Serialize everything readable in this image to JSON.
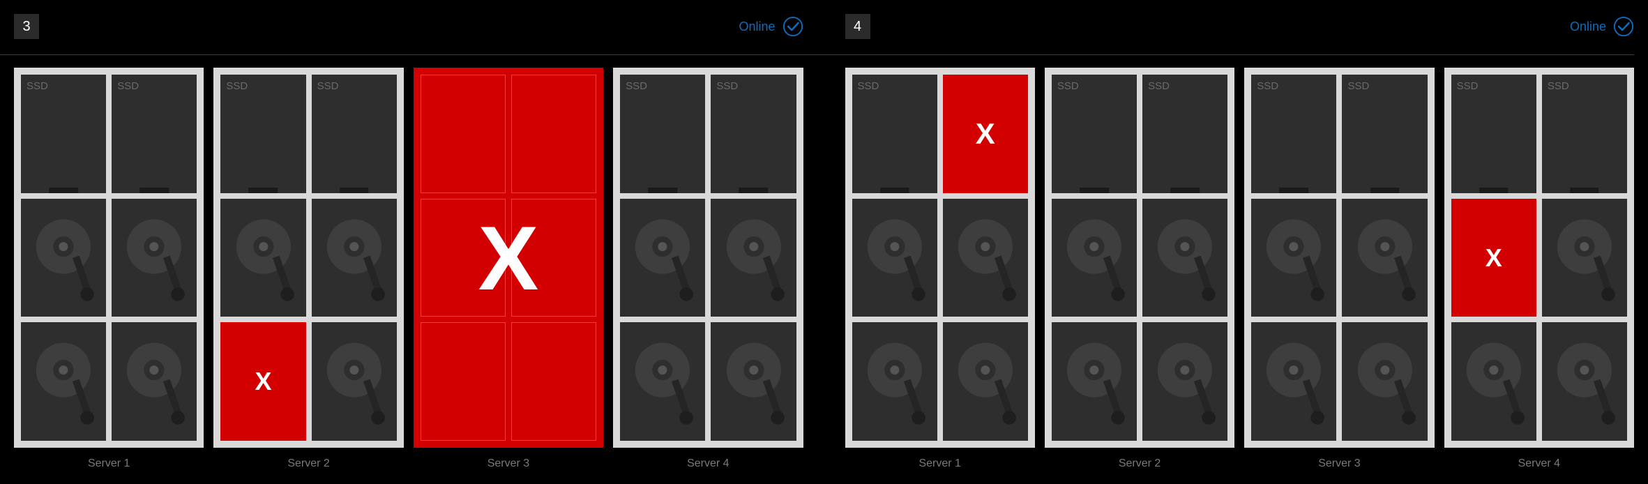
{
  "panels": [
    {
      "id": "3",
      "status": "Online",
      "servers": [
        {
          "name": "Server 1",
          "failed": false,
          "drives": [
            {
              "t": "ssd",
              "f": false
            },
            {
              "t": "ssd",
              "f": false
            },
            {
              "t": "hdd",
              "f": false
            },
            {
              "t": "hdd",
              "f": false
            },
            {
              "t": "hdd",
              "f": false
            },
            {
              "t": "hdd",
              "f": false
            }
          ]
        },
        {
          "name": "Server 2",
          "failed": false,
          "drives": [
            {
              "t": "ssd",
              "f": false
            },
            {
              "t": "ssd",
              "f": false
            },
            {
              "t": "hdd",
              "f": false
            },
            {
              "t": "hdd",
              "f": false
            },
            {
              "t": "hdd",
              "f": true
            },
            {
              "t": "hdd",
              "f": false
            }
          ]
        },
        {
          "name": "Server 3",
          "failed": true,
          "drives": [
            {
              "t": "ssd",
              "f": false
            },
            {
              "t": "ssd",
              "f": false
            },
            {
              "t": "hdd",
              "f": false
            },
            {
              "t": "hdd",
              "f": false
            },
            {
              "t": "hdd",
              "f": false
            },
            {
              "t": "hdd",
              "f": false
            }
          ]
        },
        {
          "name": "Server 4",
          "failed": false,
          "drives": [
            {
              "t": "ssd",
              "f": false
            },
            {
              "t": "ssd",
              "f": false
            },
            {
              "t": "hdd",
              "f": false
            },
            {
              "t": "hdd",
              "f": false
            },
            {
              "t": "hdd",
              "f": false
            },
            {
              "t": "hdd",
              "f": false
            }
          ]
        }
      ]
    },
    {
      "id": "4",
      "status": "Online",
      "servers": [
        {
          "name": "Server 1",
          "failed": false,
          "drives": [
            {
              "t": "ssd",
              "f": false
            },
            {
              "t": "ssd",
              "f": true
            },
            {
              "t": "hdd",
              "f": false
            },
            {
              "t": "hdd",
              "f": false
            },
            {
              "t": "hdd",
              "f": false
            },
            {
              "t": "hdd",
              "f": false
            }
          ]
        },
        {
          "name": "Server 2",
          "failed": false,
          "drives": [
            {
              "t": "ssd",
              "f": false
            },
            {
              "t": "ssd",
              "f": false
            },
            {
              "t": "hdd",
              "f": false
            },
            {
              "t": "hdd",
              "f": false
            },
            {
              "t": "hdd",
              "f": false
            },
            {
              "t": "hdd",
              "f": false
            }
          ]
        },
        {
          "name": "Server 3",
          "failed": false,
          "drives": [
            {
              "t": "ssd",
              "f": false
            },
            {
              "t": "ssd",
              "f": false
            },
            {
              "t": "hdd",
              "f": false
            },
            {
              "t": "hdd",
              "f": false
            },
            {
              "t": "hdd",
              "f": false
            },
            {
              "t": "hdd",
              "f": false
            }
          ]
        },
        {
          "name": "Server 4",
          "failed": false,
          "drives": [
            {
              "t": "ssd",
              "f": false
            },
            {
              "t": "ssd",
              "f": false
            },
            {
              "t": "hdd",
              "f": true
            },
            {
              "t": "hdd",
              "f": false
            },
            {
              "t": "hdd",
              "f": false
            },
            {
              "t": "hdd",
              "f": false
            }
          ]
        }
      ]
    }
  ],
  "labels": {
    "ssd": "SSD"
  }
}
